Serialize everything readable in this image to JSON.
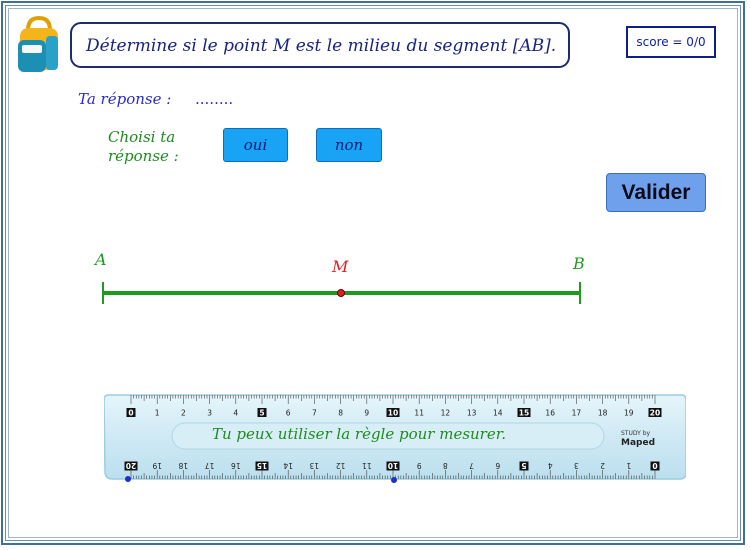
{
  "question": {
    "text": "Détermine si le point M est le milieu du segment [AB]."
  },
  "score": {
    "text": "score = 0/0"
  },
  "answer": {
    "label": "Ta réponse :",
    "value": "........"
  },
  "choice": {
    "label_line1": "Choisi ta",
    "label_line2": "réponse :",
    "oui_label": "oui",
    "non_label": "non"
  },
  "valider_label": "Valider",
  "segment": {
    "point_a": "A",
    "point_m": "M",
    "point_b": "B"
  },
  "ruler": {
    "caption": "Tu peux utiliser la règle pour mesurer.",
    "top_numbers": [
      "0",
      "1",
      "2",
      "3",
      "4",
      "5",
      "6",
      "7",
      "8",
      "9",
      "10",
      "11",
      "12",
      "13",
      "14",
      "15",
      "16",
      "17",
      "18",
      "19",
      "20"
    ],
    "brand_small": "STUDY by",
    "brand": "Maped"
  },
  "colors": {
    "segment": "#1e9a1e",
    "point_m": "#e02020",
    "button": "#19a3f5",
    "valider": "#6fa0ec",
    "ruler": "#d6eef7"
  }
}
